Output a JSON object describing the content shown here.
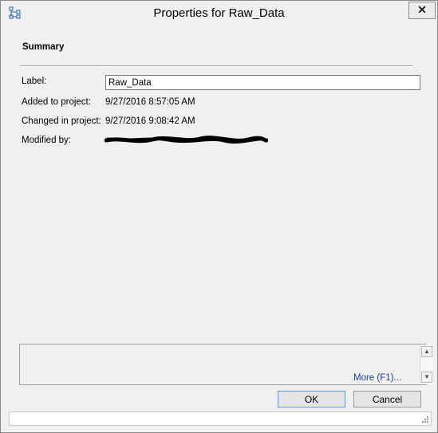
{
  "window": {
    "title": "Properties for Raw_Data",
    "close_glyph": "✕"
  },
  "summary": {
    "heading": "Summary",
    "fields": [
      {
        "label": "Label:",
        "value": "Raw_Data",
        "editable": true
      },
      {
        "label": "Added to project:",
        "value": "9/27/2016 8:57:05 AM"
      },
      {
        "label": "Changed in project:",
        "value": "9/27/2016 9:08:42 AM"
      },
      {
        "label": "Modified by:",
        "value": "",
        "redacted": true
      }
    ]
  },
  "help": {
    "link_label": "More (F1)..."
  },
  "buttons": {
    "ok": "OK",
    "cancel": "Cancel"
  },
  "icons": {
    "app": "hierarchy-icon",
    "close": "close-icon",
    "scroll_up": "scroll-up-arrow-icon",
    "scroll_down": "scroll-down-arrow-icon",
    "grip": "resize-grip-icon"
  },
  "colors": {
    "window_bg": "#f0f0f0",
    "link": "#1a3f9c",
    "ok_border": "#5a9bd6"
  }
}
